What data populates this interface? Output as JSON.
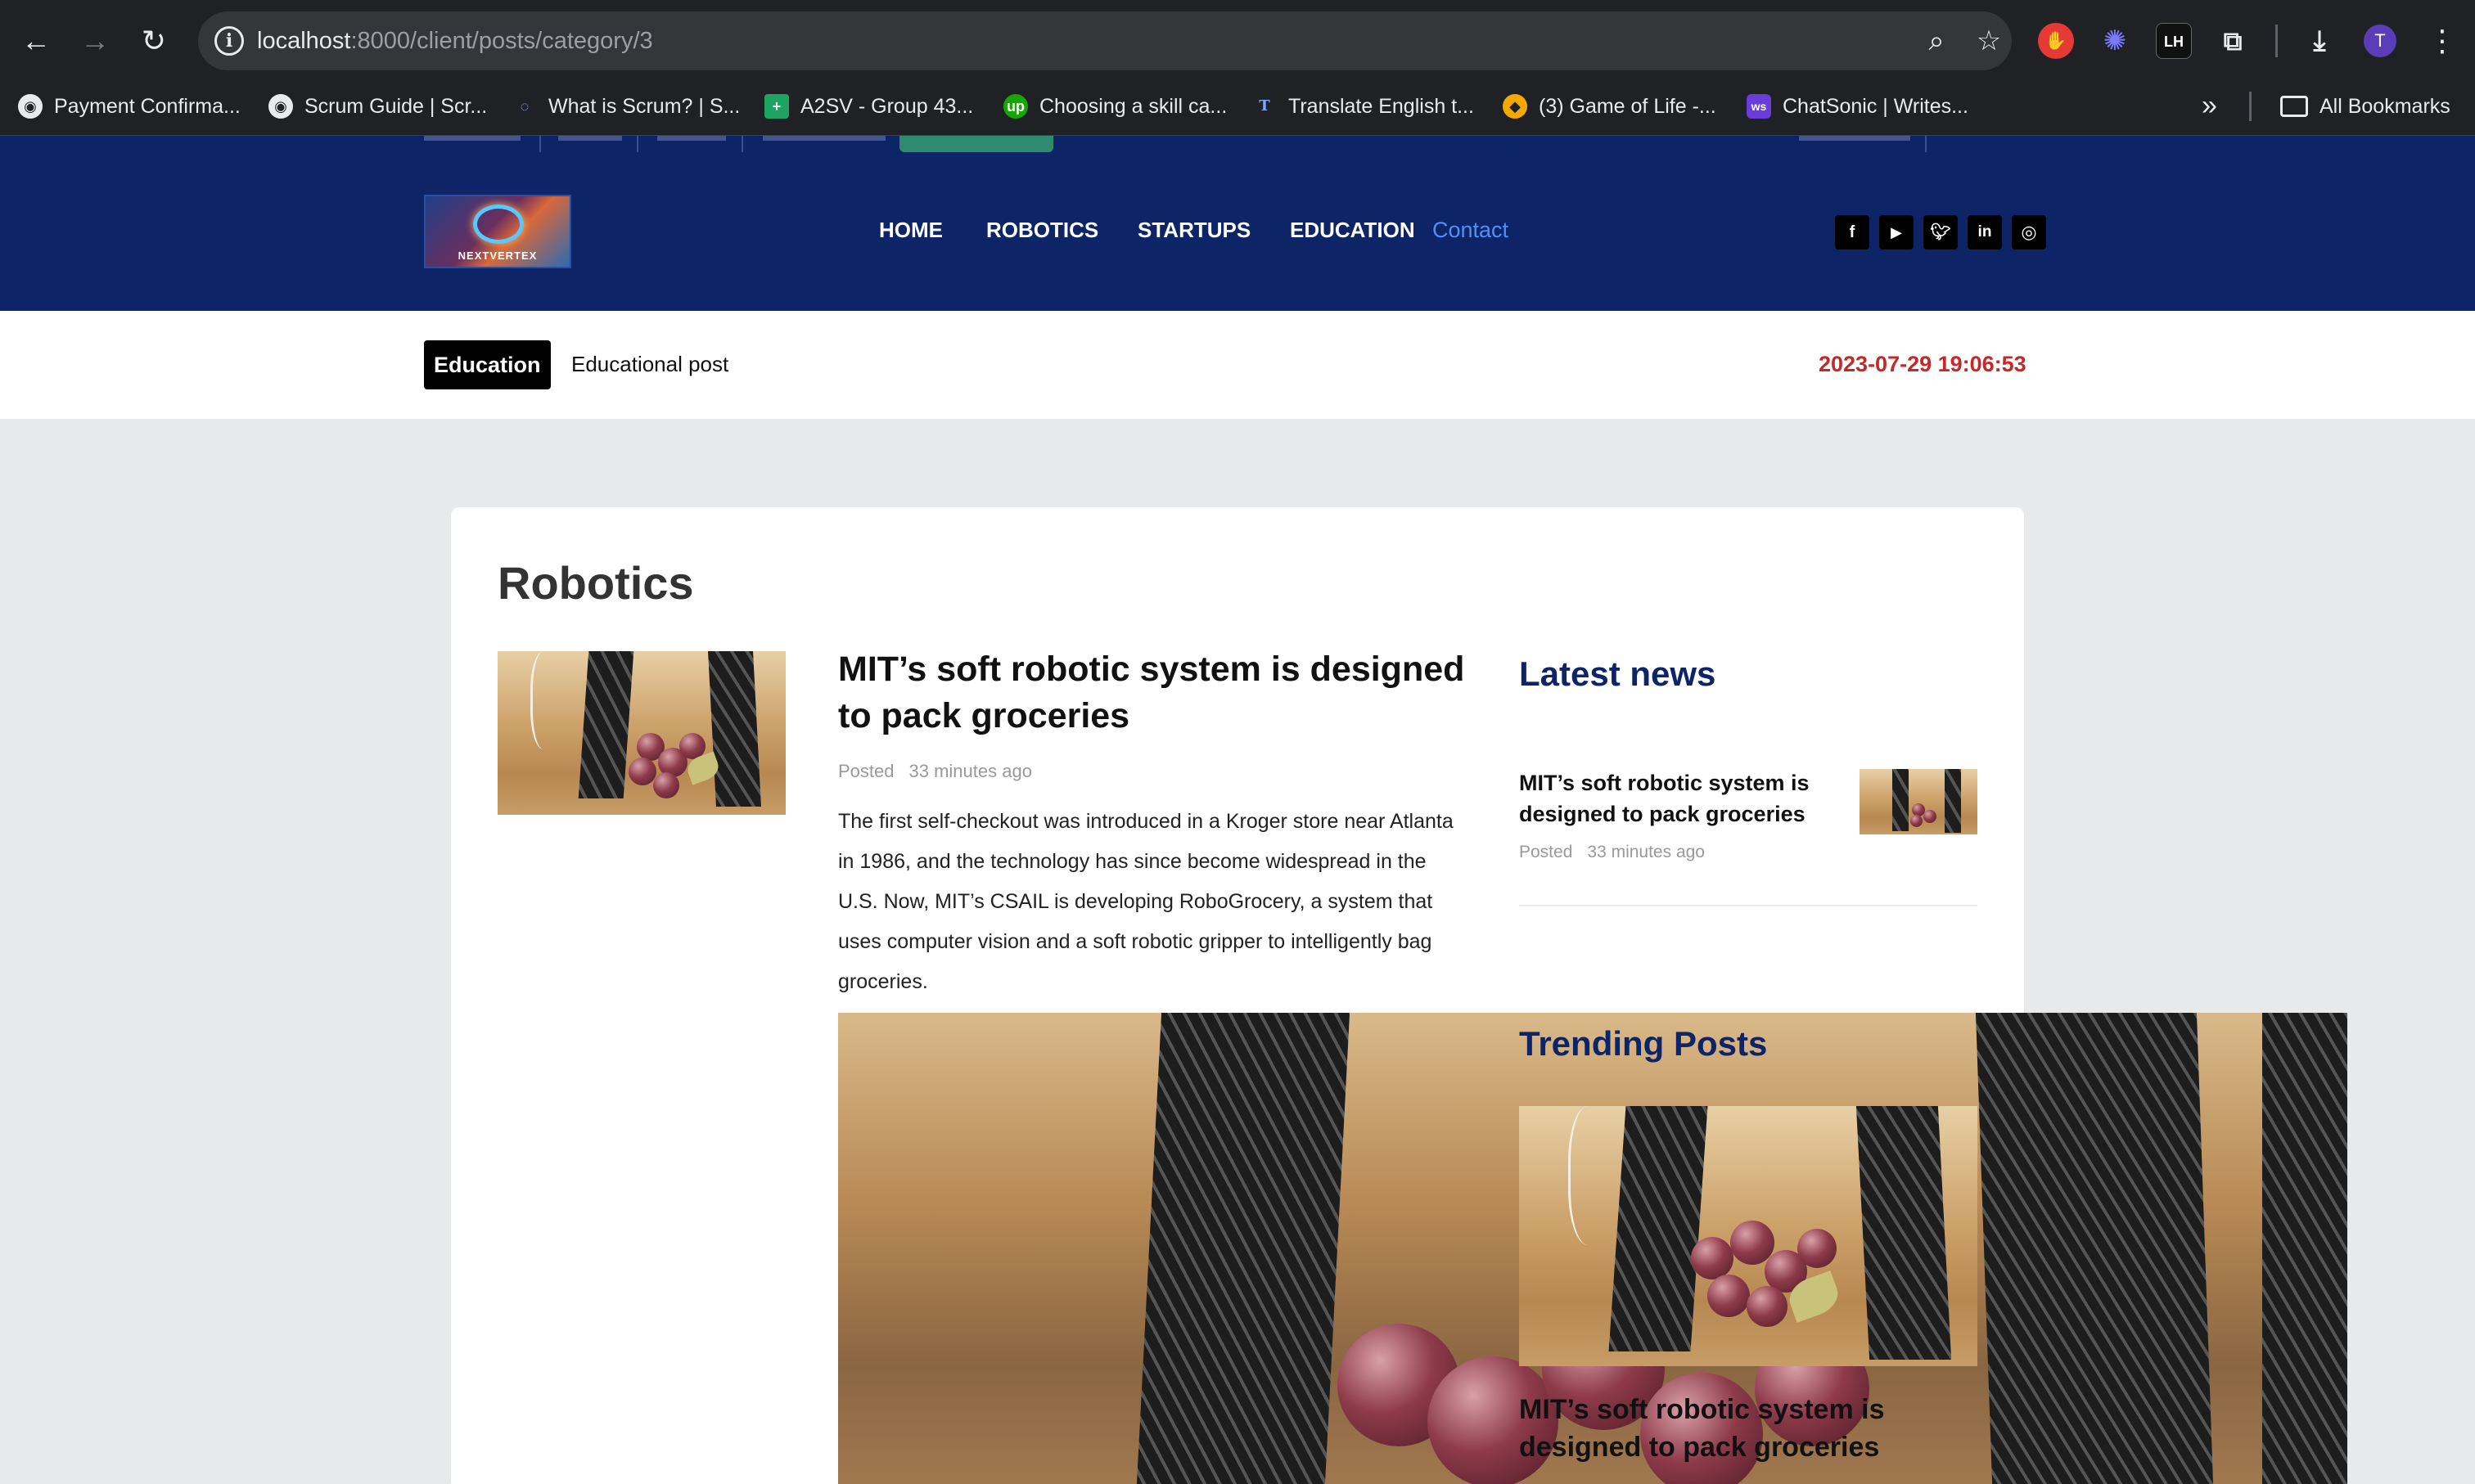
{
  "browser": {
    "url_host": "localhost",
    "url_path": ":8000/client/posts/category/3",
    "profile_initial": "T",
    "bookmarks": [
      {
        "label": "Payment Confirma...",
        "icon": "globe-icon"
      },
      {
        "label": "Scrum Guide | Scr...",
        "icon": "globe-icon"
      },
      {
        "label": "What is Scrum? | S...",
        "icon": "scrum-icon"
      },
      {
        "label": "A2SV - Group 43...",
        "icon": "sheets-icon"
      },
      {
        "label": "Choosing a skill ca...",
        "icon": "upwork-icon"
      },
      {
        "label": "Translate English t...",
        "icon": "translate-icon"
      },
      {
        "label": "(3) Game of Life -...",
        "icon": "game-icon"
      },
      {
        "label": "ChatSonic | Writes...",
        "icon": "chatsonic-icon"
      }
    ],
    "all_bookmarks_label": "All Bookmarks",
    "extension_lh_label": "LH"
  },
  "site": {
    "logo_text": "NEXTVERTEX",
    "nav": [
      {
        "label": "HOME",
        "active": false
      },
      {
        "label": "ROBOTICS",
        "active": false
      },
      {
        "label": "STARTUPS",
        "active": false
      },
      {
        "label": "EDUCATION",
        "active": false
      },
      {
        "label": "Contact",
        "active": true
      }
    ],
    "social": [
      "facebook-icon",
      "youtube-icon",
      "twitter-icon",
      "linkedin-icon",
      "instagram-icon"
    ],
    "nav_color": "#0d2466",
    "contact_color": "#4f8ff7"
  },
  "ticker": {
    "badge": "Education",
    "text": "Educational post",
    "datetime": "2023-07-29 19:06:53"
  },
  "main": {
    "title": "Robotics",
    "post": {
      "title": "MIT’s soft robotic system is designed to pack groceries",
      "posted_label": "Posted",
      "time_ago": "33 minutes ago",
      "excerpt": "The first self-checkout was introduced in a Kroger store near Atlanta in 1986, and the technology has since become widespread in the U.S. Now, MIT’s CSAIL is developing RoboGrocery, a system that uses computer vision and a soft robotic gripper to intelligently bag groceries."
    }
  },
  "sidebar": {
    "latest_heading": "Latest news",
    "latest": [
      {
        "title": "MIT’s soft robotic system is designed to pack groceries",
        "posted_label": "Posted",
        "time_ago": "33 minutes ago"
      }
    ],
    "trending_heading": "Trending Posts",
    "trending": [
      {
        "title": "MIT’s soft robotic system is designed to pack groceries"
      }
    ]
  }
}
